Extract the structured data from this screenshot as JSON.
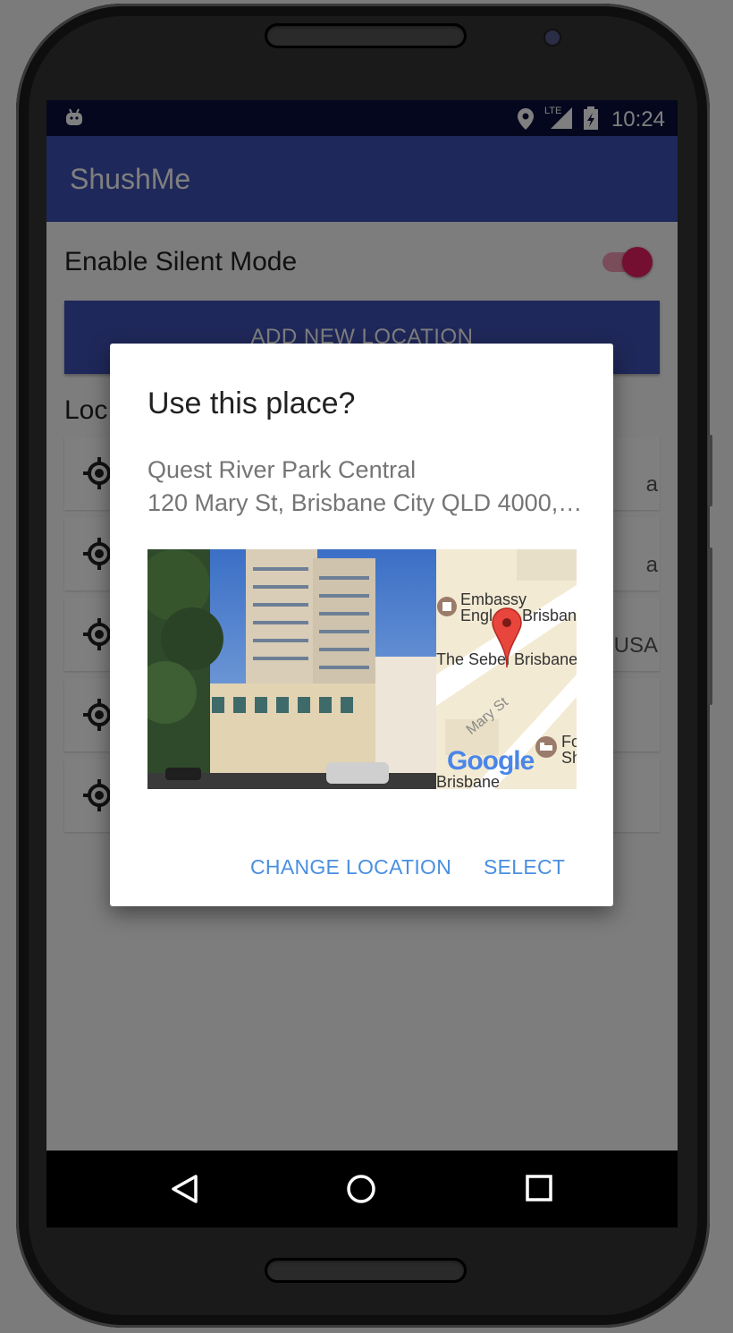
{
  "status_bar": {
    "network": "LTE",
    "time": "10:24"
  },
  "app": {
    "title": "ShushMe"
  },
  "settings": {
    "silent_mode_label": "Enable Silent Mode",
    "silent_mode_enabled": true
  },
  "actions": {
    "add_location_label": "ADD NEW LOCATION"
  },
  "locations": {
    "header": "Loc",
    "rows": [
      {
        "trailing_text": "a"
      },
      {
        "trailing_text": "a"
      },
      {
        "trailing_text": ", USA"
      },
      {
        "trailing_text": ""
      },
      {
        "trailing_text": ""
      }
    ]
  },
  "dialog": {
    "title": "Use this place?",
    "place_name": "Quest River Park Central",
    "place_address": "120 Mary St, Brisbane City QLD 4000,…",
    "map": {
      "labels": [
        "Embassy",
        "Engl",
        "Brisban",
        "The Sebel Brisbane",
        "Mary St",
        "Fo",
        "Sh",
        "Brisbane"
      ],
      "logo": "Google"
    },
    "buttons": {
      "change_location": "CHANGE LOCATION",
      "select": "SELECT"
    }
  },
  "colors": {
    "primary": "#3f51b5",
    "status_bar": "#0a0f3c",
    "accent": "#e91e63",
    "dialog_button": "#4a8fe0"
  },
  "icons": {
    "status": [
      "android-notification-icon",
      "location-pin-icon",
      "lte-signal-icon",
      "battery-charging-icon"
    ],
    "nav": [
      "back-icon",
      "home-icon",
      "recents-icon"
    ],
    "location_row": "gps-target-icon"
  }
}
